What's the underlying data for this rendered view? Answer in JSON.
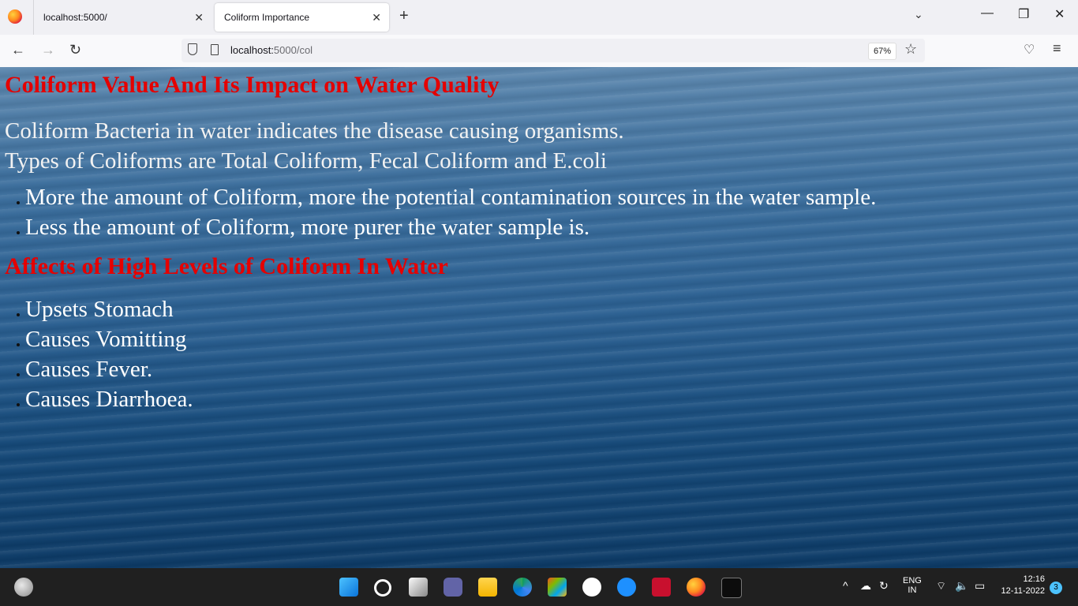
{
  "browser": {
    "tabs": [
      {
        "title": "localhost:5000/",
        "active": false
      },
      {
        "title": "Coliform Importance",
        "active": true
      }
    ],
    "url_host": "localhost:",
    "url_rest": "5000/col",
    "zoom": "67%"
  },
  "page": {
    "heading": "Coliform Value And Its Impact on Water Quality",
    "intro_lines": [
      "Coliform Bacteria in water indicates the disease causing organisms.",
      "Types of Coliforms are Total Coliform, Fecal Coliform and E.coli"
    ],
    "points": [
      "More the amount of Coliform, more the potential contamination sources in the water sample.",
      "Less the amount of Coliform, more purer the water sample is."
    ],
    "subheading": "Affects of High Levels of Coliform In Water",
    "effects": [
      "Upsets Stomach",
      "Causes Vomitting",
      "Causes Fever.",
      "Causes Diarrhoea."
    ]
  },
  "taskbar": {
    "language_top": "ENG",
    "language_bottom": "IN",
    "time": "12:16",
    "date": "12-11-2022",
    "notification_count": "3"
  },
  "colors": {
    "heading": "#e50000",
    "text": "#ffffff",
    "taskbar": "#202020"
  }
}
